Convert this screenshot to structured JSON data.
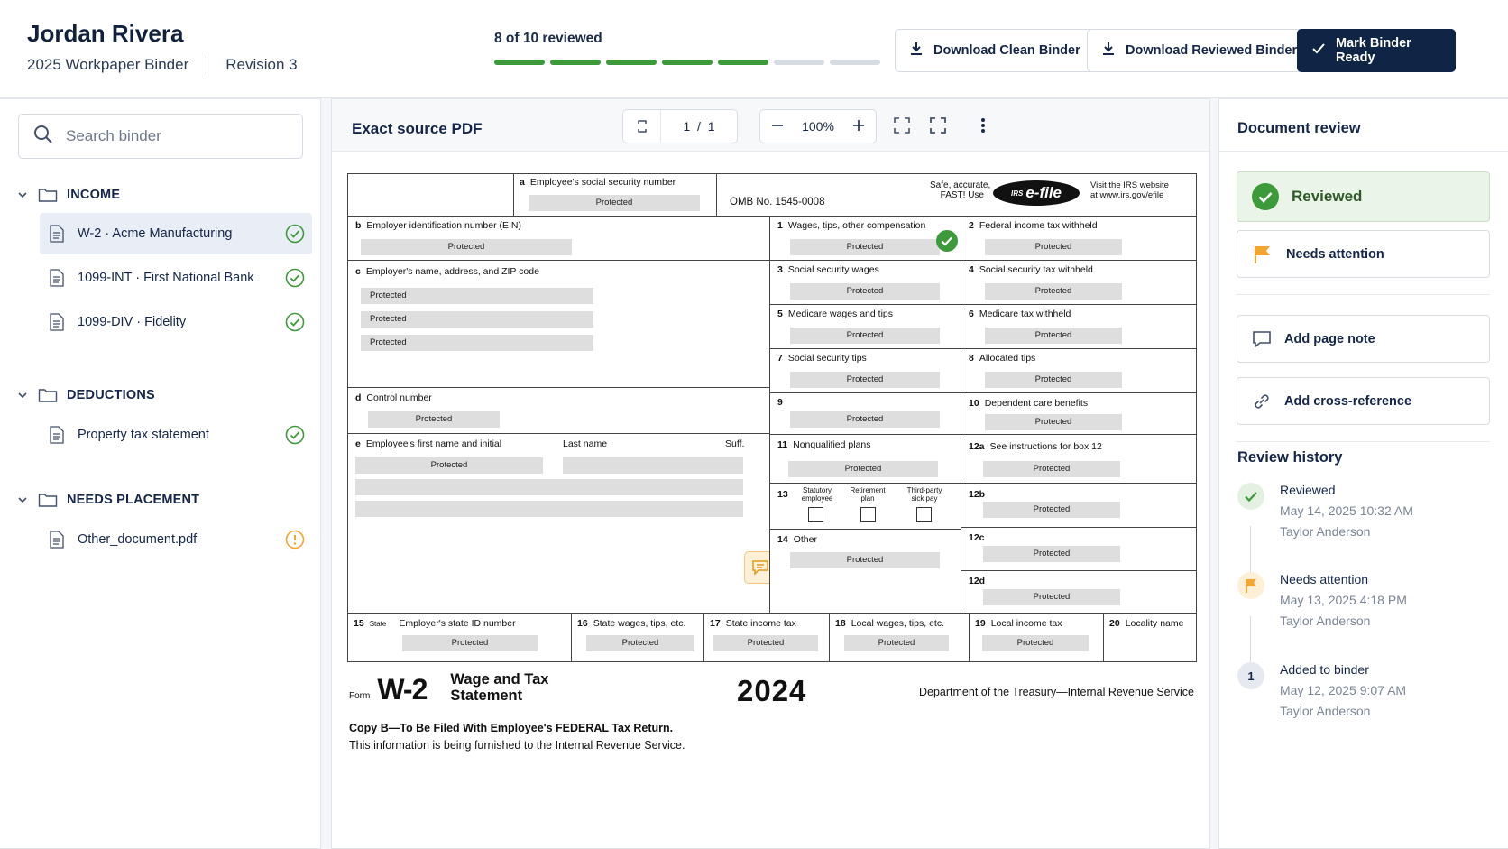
{
  "header": {
    "client_name": "Jordan Rivera",
    "binder_name": "2025 Workpaper Binder",
    "revision": "Revision 3",
    "progress_label": "8 of 10 reviewed",
    "progress_done": 5,
    "progress_total": 7,
    "download_clean": "Download Clean Binder",
    "download_reviewed": "Download Reviewed Binder",
    "mark_ready": "Mark Binder Ready"
  },
  "sidebar": {
    "search_placeholder": "Search binder",
    "groups": [
      {
        "label": "INCOME"
      },
      {
        "label": "DEDUCTIONS"
      },
      {
        "label": "NEEDS PLACEMENT"
      }
    ],
    "docs": [
      {
        "label": "W-2 · Acme Manufacturing",
        "status": "reviewed"
      },
      {
        "label": "1099-INT · First National Bank",
        "status": "reviewed"
      },
      {
        "label": "1099-DIV · Fidelity",
        "status": "reviewed"
      },
      {
        "label": "Property tax statement",
        "status": "reviewed"
      },
      {
        "label": "Other_document.pdf",
        "status": "attention"
      }
    ]
  },
  "viewer": {
    "title": "Exact source PDF",
    "page_current": "1",
    "page_sep": "/",
    "page_total": "1",
    "zoom": "100%"
  },
  "w2": {
    "a": "Employee's social security number",
    "omb": "OMB No. 1545-0008",
    "safe": "Safe, accurate,",
    "fast": "FAST! Use",
    "efile": "e-file",
    "irs": "IRS",
    "visit1": "Visit the IRS website",
    "visit2": "at www.irs.gov/efile",
    "b": "Employer identification number (EIN)",
    "c": "Employer's name, address, and ZIP code",
    "d": "Control number",
    "e": "Employee's first name and initial",
    "last": "Last name",
    "suff": "Suff.",
    "box1": "Wages, tips, other compensation",
    "box2": "Federal income tax withheld",
    "box3": "Social security wages",
    "box4": "Social security tax withheld",
    "box5": "Medicare wages and tips",
    "box6": "Medicare tax withheld",
    "box7": "Social security tips",
    "box8": "Allocated tips",
    "box10": "Dependent care benefits",
    "box11": "Nonqualified plans",
    "box12a": "See instructions for box 12",
    "box13a": "Statutory employee",
    "box13b": "Retirement plan",
    "box13c": "Third-party sick pay",
    "box14": "Other",
    "box15": "Employer's state ID number",
    "box15s": "State",
    "box16": "State wages, tips, etc.",
    "box17": "State income tax",
    "box18": "Local wages, tips, etc.",
    "box19": "Local income tax",
    "box20": "Locality name",
    "protected": "Protected",
    "form_word": "Form",
    "form_code": "W-2",
    "form_title1": "Wage and Tax",
    "form_title2": "Statement",
    "year": "2024",
    "dept": "Department of the Treasury—Internal Revenue Service",
    "copy_b": "Copy B—To Be Filed With Employee's FEDERAL Tax Return.",
    "furnished": "This information is being furnished to the Internal Revenue Service."
  },
  "review": {
    "title": "Document review",
    "reviewed": "Reviewed",
    "needs_attention": "Needs attention",
    "add_note": "Add page note",
    "add_xref": "Add cross-reference",
    "history_title": "Review history",
    "history": [
      {
        "action": "Reviewed",
        "time": "May 14, 2025 10:32 AM",
        "user": "Taylor Anderson"
      },
      {
        "action": "Needs attention",
        "time": "May 13, 2025 4:18 PM",
        "user": "Taylor Anderson"
      },
      {
        "action": "Added to binder",
        "time": "May 12, 2025 9:07 AM",
        "user": "Taylor Anderson",
        "step": "1"
      }
    ]
  },
  "colors": {
    "navy": "#102445",
    "green": "#3d9a3a",
    "amber": "#f2a531",
    "selected_bg": "#e9eef6"
  }
}
